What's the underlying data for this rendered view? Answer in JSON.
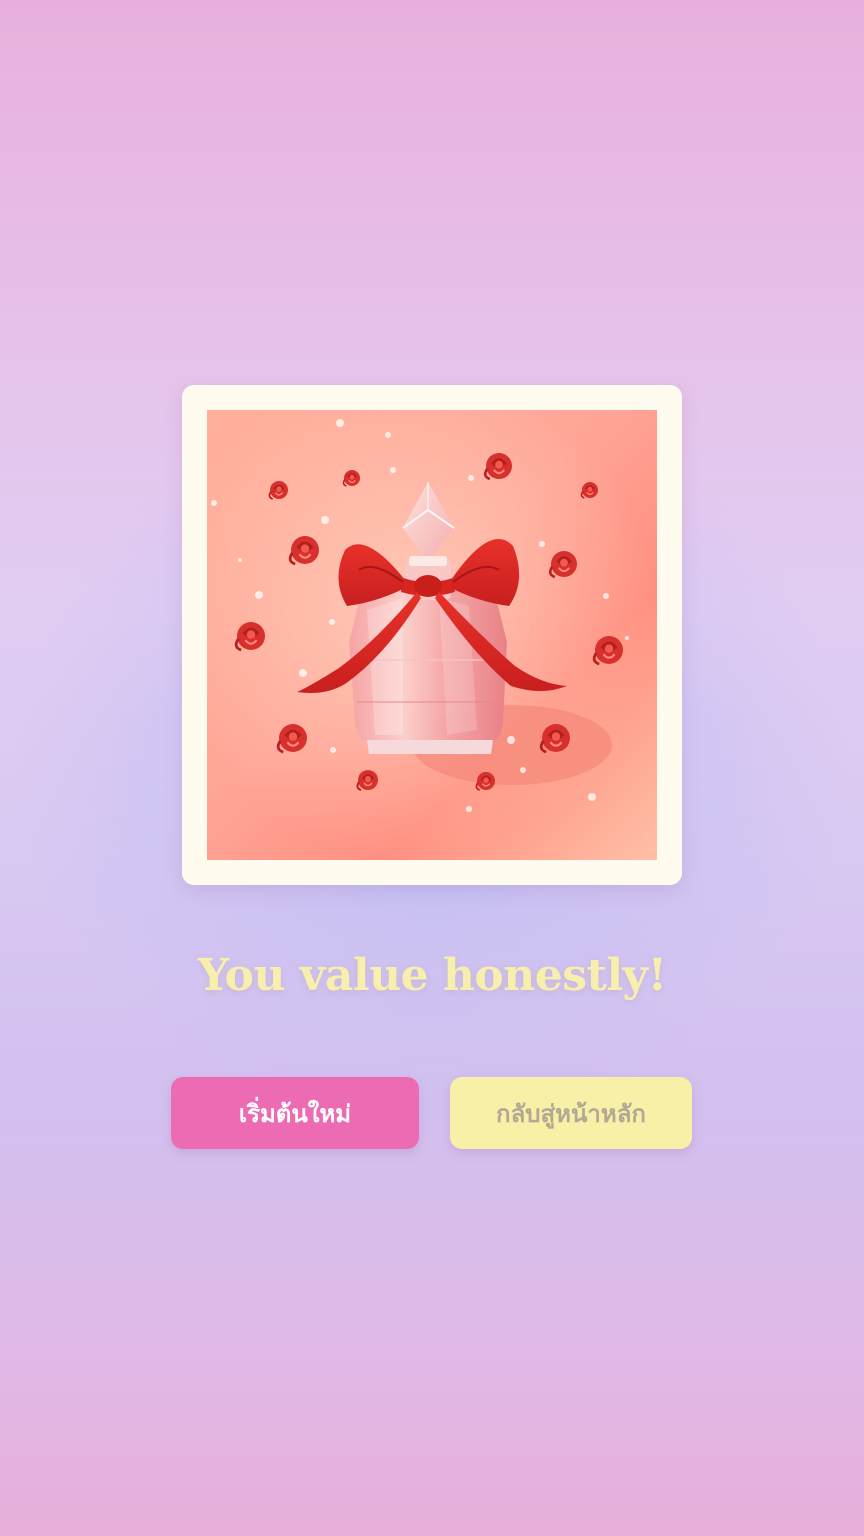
{
  "result": {
    "title": "You value honestly!",
    "image_subject": "perfume bottle with red bow and roses"
  },
  "buttons": {
    "restart_label": "เริ่มต้นใหม่",
    "home_label": "กลับสู่หน้าหลัก"
  },
  "colors": {
    "restart_button": "#ec6bb3",
    "home_button": "#f9f0a7",
    "title_text": "#f8eeae",
    "frame": "#fffbef"
  }
}
